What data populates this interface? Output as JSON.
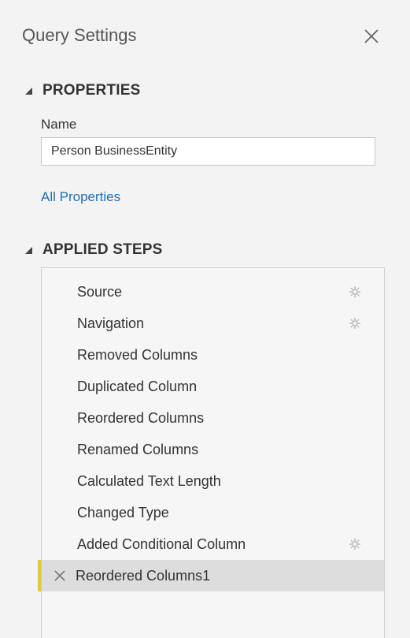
{
  "panel": {
    "title": "Query Settings"
  },
  "properties": {
    "header": "PROPERTIES",
    "name_label": "Name",
    "name_value": "Person BusinessEntity",
    "all_properties_link": "All Properties"
  },
  "applied_steps": {
    "header": "APPLIED STEPS",
    "steps": [
      {
        "label": "Source",
        "has_settings": true,
        "selected": false
      },
      {
        "label": "Navigation",
        "has_settings": true,
        "selected": false
      },
      {
        "label": "Removed Columns",
        "has_settings": false,
        "selected": false
      },
      {
        "label": "Duplicated Column",
        "has_settings": false,
        "selected": false
      },
      {
        "label": "Reordered Columns",
        "has_settings": false,
        "selected": false
      },
      {
        "label": "Renamed Columns",
        "has_settings": false,
        "selected": false
      },
      {
        "label": "Calculated Text Length",
        "has_settings": false,
        "selected": false
      },
      {
        "label": "Changed Type",
        "has_settings": false,
        "selected": false
      },
      {
        "label": "Added Conditional Column",
        "has_settings": true,
        "selected": false
      },
      {
        "label": "Reordered Columns1",
        "has_settings": false,
        "selected": true
      }
    ]
  },
  "colors": {
    "link": "#1f6fb2",
    "selected_accent": "#e8c443",
    "selected_background": "#dddddd"
  },
  "icons": {
    "close": "close-icon",
    "collapse": "collapse-triangle-icon",
    "settings": "gear-icon",
    "delete": "delete-step-icon"
  }
}
